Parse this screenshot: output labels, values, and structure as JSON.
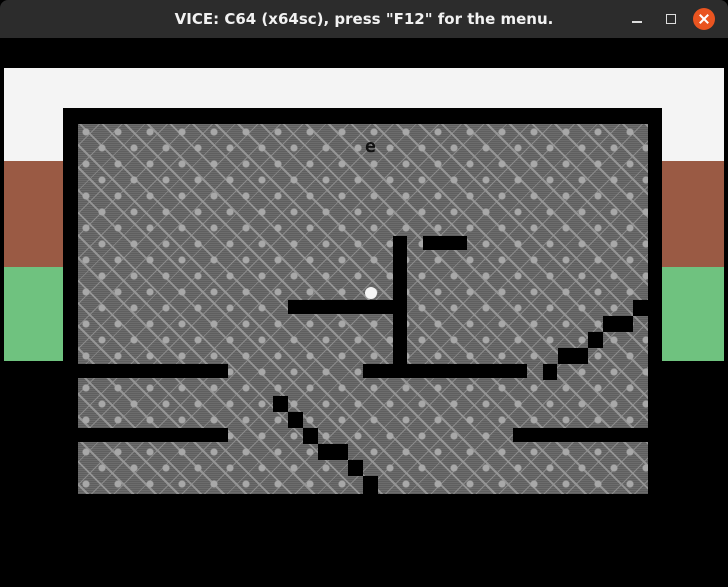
{
  "window": {
    "title": "VICE: C64 (x64sc), press \"F12\" for the menu."
  },
  "icons": {
    "minimize": "minimize-icon",
    "maximize": "maximize-icon",
    "close": "close-icon"
  },
  "game": {
    "player_glyph": "e"
  },
  "colors": {
    "titlebar": "#2c2c2c",
    "close_button": "#e95420",
    "sky": "#f4f4f4",
    "red_stripe": "#9a5a44",
    "green_stripe": "#6fc27f",
    "floor_pattern": "#6c6c6c"
  }
}
